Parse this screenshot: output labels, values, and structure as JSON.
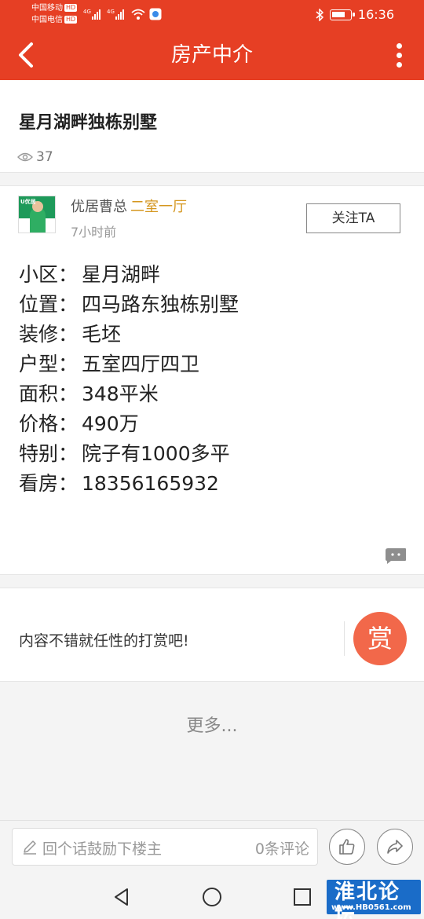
{
  "status_bar": {
    "carrier1": "中国移动",
    "carrier2": "中国电信",
    "hd_badge": "HD",
    "net_type": "4G",
    "time": "16:36"
  },
  "header": {
    "title": "房产中介"
  },
  "post": {
    "title": "星月湖畔独栋别墅",
    "view_count": "37"
  },
  "author": {
    "name": "优居曹总",
    "tag": "二室一厅",
    "time": "7小时前",
    "follow_label": "关注TA",
    "avatar_brand": "U优居"
  },
  "details": [
    {
      "label": "小区：",
      "value": "星月湖畔"
    },
    {
      "label": "位置：",
      "value": "四马路东独栋别墅"
    },
    {
      "label": "装修：",
      "value": "毛坯"
    },
    {
      "label": "户型：",
      "value": "五室四厅四卫"
    },
    {
      "label": "面积：",
      "value": "348平米"
    },
    {
      "label": "价格：",
      "value": "490万"
    },
    {
      "label": "特别：",
      "value": "院子有1000多平"
    },
    {
      "label": "看房：",
      "value": "18356165932"
    }
  ],
  "reward": {
    "text": "内容不错就任性的打赏吧!",
    "button_label": "赏"
  },
  "more_label": "更多...",
  "reply_bar": {
    "placeholder": "回个话鼓励下楼主",
    "comment_count": "0条评论"
  },
  "watermark": {
    "title": "淮北论坛",
    "url": "www.HB0561.com"
  },
  "colors": {
    "brand_red": "#e63f24",
    "tag_gold": "#d4961e",
    "reward_orange": "#f2684a"
  }
}
